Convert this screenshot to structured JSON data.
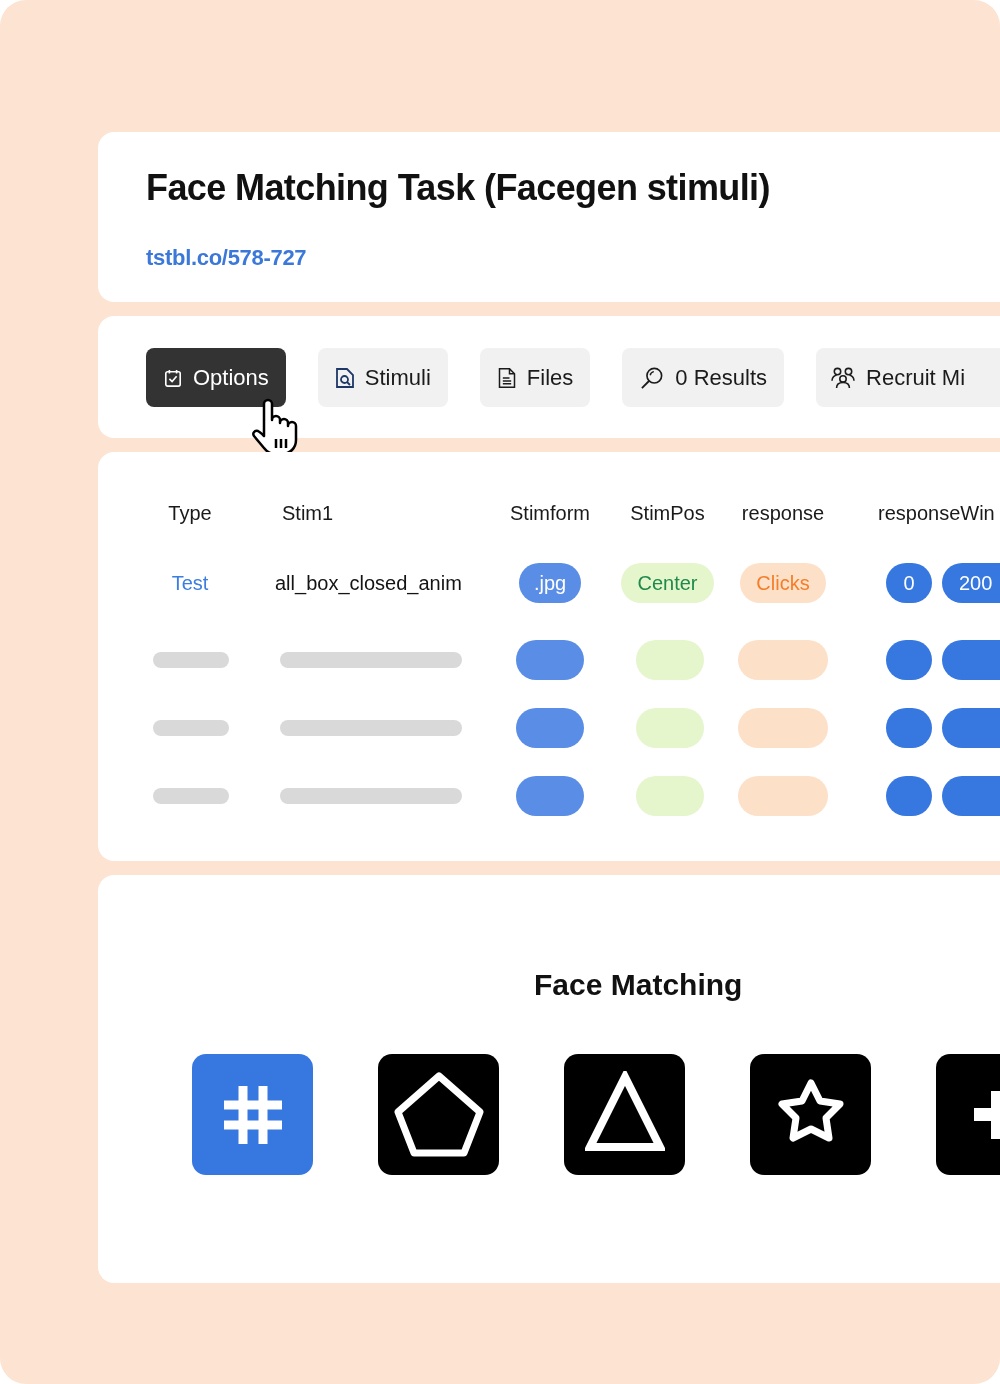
{
  "header": {
    "title": "Face Matching Task (Facegen stimuli)",
    "link": "tstbl.co/578-727"
  },
  "tabs": [
    {
      "label": "Options",
      "selected": true
    },
    {
      "label": "Stimuli",
      "selected": false
    },
    {
      "label": "Files",
      "selected": false
    },
    {
      "label": "0 Results",
      "selected": false
    },
    {
      "label": "Recruit Mi",
      "selected": false
    }
  ],
  "table": {
    "columns": [
      "Type",
      "Stim1",
      "Stimform",
      "StimPos",
      "response",
      "responseWin"
    ],
    "rows": [
      {
        "kind": "data",
        "cells": [
          "Test",
          "all_box_closed_anim",
          ".jpg",
          "Center",
          "Clicks"
        ],
        "response_window": [
          "0",
          "200"
        ]
      },
      {
        "kind": "skeleton"
      },
      {
        "kind": "skeleton"
      },
      {
        "kind": "skeleton"
      }
    ]
  },
  "preview": {
    "title": "Face Matching",
    "tiles": [
      {
        "selected": true
      },
      {
        "selected": false
      },
      {
        "selected": false
      },
      {
        "selected": false
      },
      {
        "selected": false
      }
    ]
  }
}
